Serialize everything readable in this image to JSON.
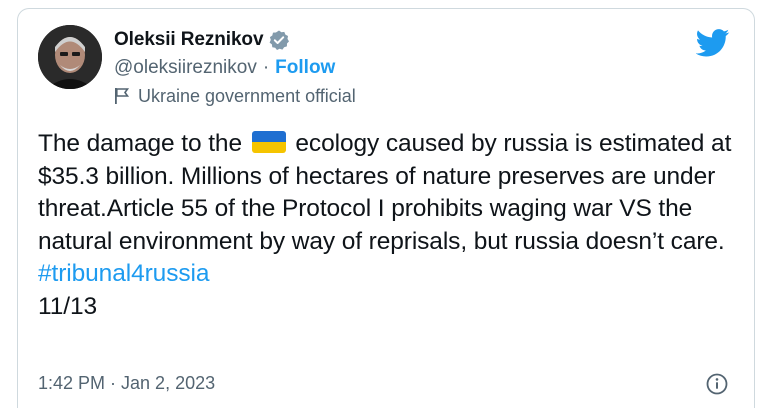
{
  "author": {
    "display_name": "Oleksii Reznikov",
    "handle": "@oleksiireznikov",
    "separator": "·",
    "follow_label": "Follow",
    "affiliation_label": "Ukraine government official"
  },
  "tweet": {
    "text_before_flag": "The damage to the",
    "flag_emoji": "🇺🇦",
    "text_after_flag": "ecology caused by russia is estimated at $35.3 billion. Millions of hectares of nature preserves are under threat.Article 55 of the Protocol I prohibits waging war VS the natural environment by way of reprisals, but russia doesn’t care.",
    "hashtag": "#tribunal4russia",
    "counter": "11/13"
  },
  "footer": {
    "timestamp": "1:42 PM · Jan 2, 2023"
  },
  "icons": {
    "verified": "verified-badge-icon",
    "affiliation": "flag-icon",
    "brand": "twitter-bird-icon",
    "info": "info-icon"
  },
  "colors": {
    "link": "#1d9bf0",
    "text": "#0f1419",
    "muted": "#536471",
    "flag_blue": "#1f6fd1",
    "flag_yellow": "#f5c400"
  }
}
